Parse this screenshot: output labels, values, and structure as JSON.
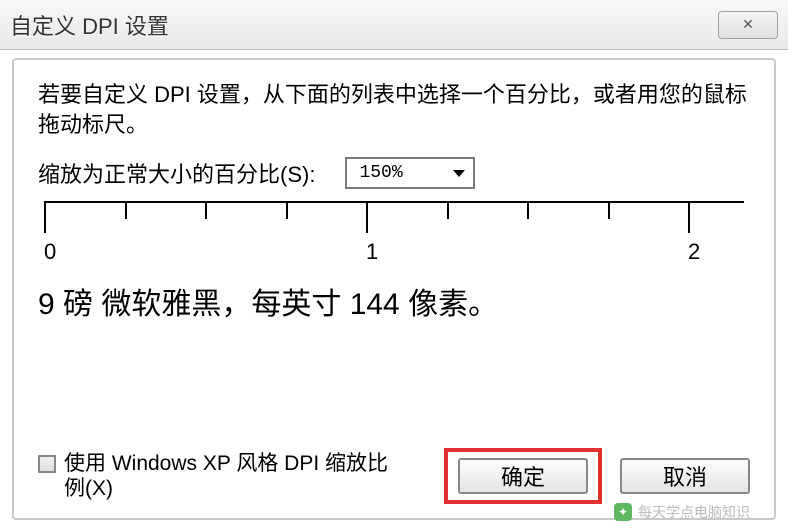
{
  "titlebar": {
    "title": "自定义 DPI 设置",
    "close_glyph": "✕"
  },
  "dialog": {
    "instruction": "若要自定义 DPI 设置，从下面的列表中选择一个百分比，或者用您的鼠标拖动标尺。",
    "scale_label": "缩放为正常大小的百分比(S):",
    "scale_value": "150%",
    "ruler": {
      "ticks": [
        "0",
        "1",
        "2"
      ]
    },
    "sample_text": "9 磅 微软雅黑，每英寸 144 像素。",
    "checkbox_label": "使用 Windows XP 风格 DPI 缩放比例(X)",
    "ok_label": "确定",
    "cancel_label": "取消"
  },
  "watermark": {
    "text": "每天学点电脑知识"
  }
}
